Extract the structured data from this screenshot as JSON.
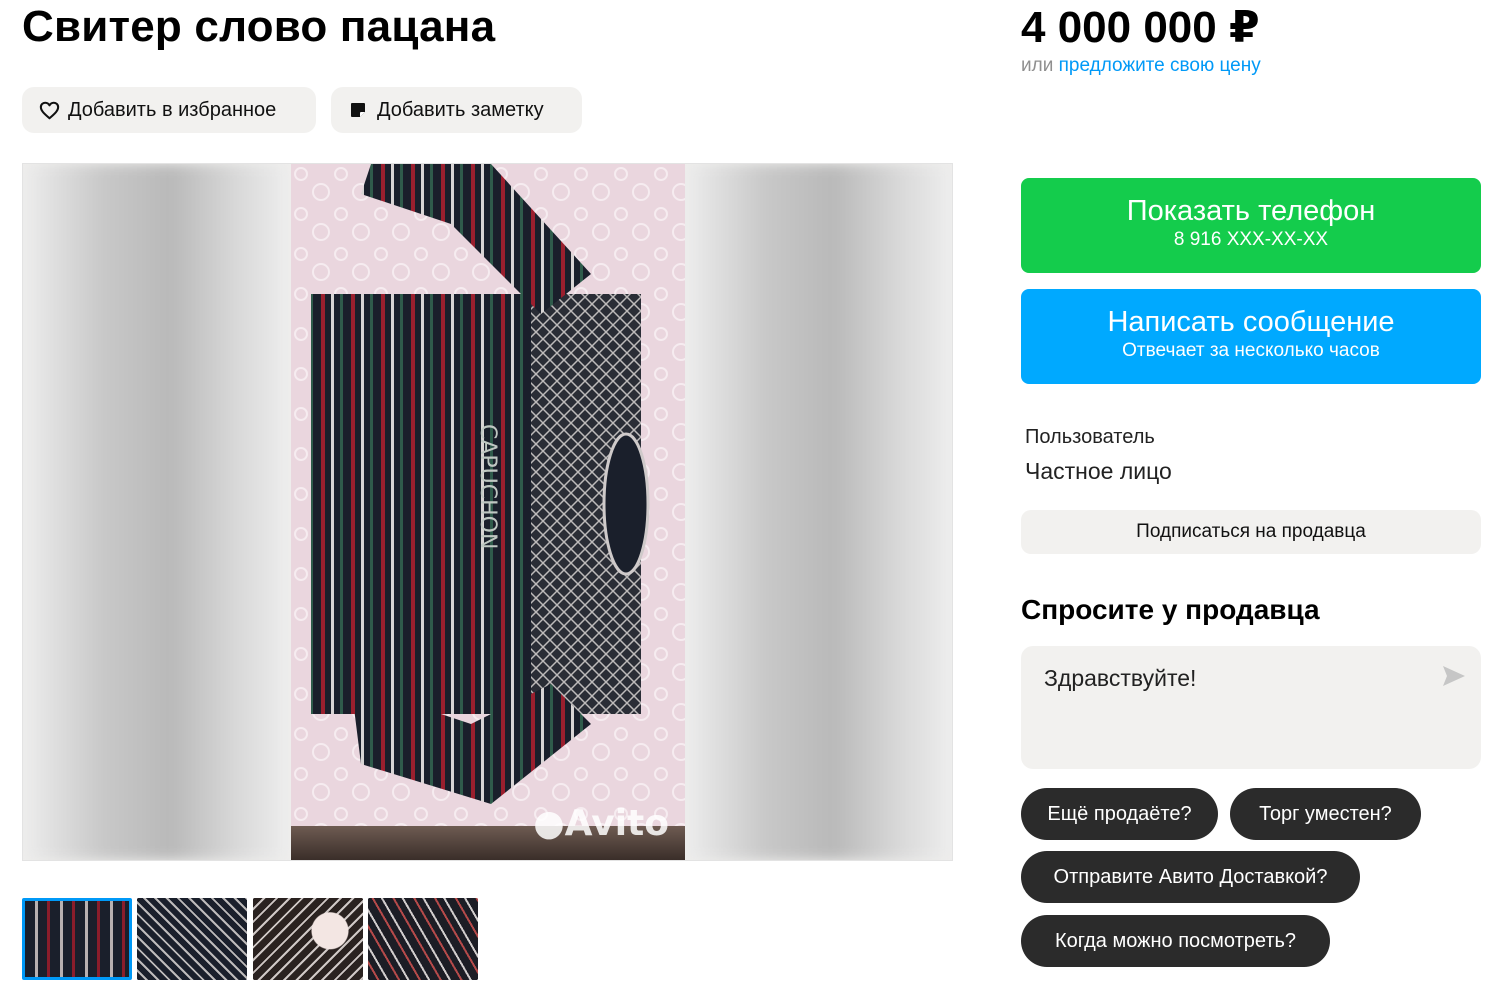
{
  "listing": {
    "title": "Свитер слово пацана",
    "price": "4 000 000 ₽",
    "price_or": "или",
    "price_offer_link": "предложите свою цену"
  },
  "actions": {
    "favorite_label": "Добавить в избранное",
    "note_label": "Добавить заметку"
  },
  "gallery": {
    "watermark": "Avito",
    "logo_text": "CAPUCHON",
    "thumbnail_count": 4,
    "selected_index": 0
  },
  "contact": {
    "show_phone_label": "Показать телефон",
    "phone_masked": "8 916 XXX-XX-XX",
    "message_label": "Написать сообщение",
    "response_time": "Отвечает за несколько часов"
  },
  "seller": {
    "role": "Пользователь",
    "type": "Частное лицо",
    "subscribe_label": "Подписаться на продавца"
  },
  "ask": {
    "title": "Спросите у продавца",
    "message_value": "Здравствуйте!",
    "chips": [
      "Ещё продаёте?",
      "Торг уместен?",
      "Отправите Авито Доставкой?",
      "Когда можно посмотреть?"
    ]
  },
  "colors": {
    "phone_button": "#14cc4c",
    "message_button": "#00a9ff",
    "link": "#0099f7",
    "chip_bg": "#2b2b2b",
    "soft_bg": "#f2f1ef"
  },
  "icons": {
    "favorite": "heart-icon",
    "note": "note-icon",
    "send": "send-icon"
  }
}
